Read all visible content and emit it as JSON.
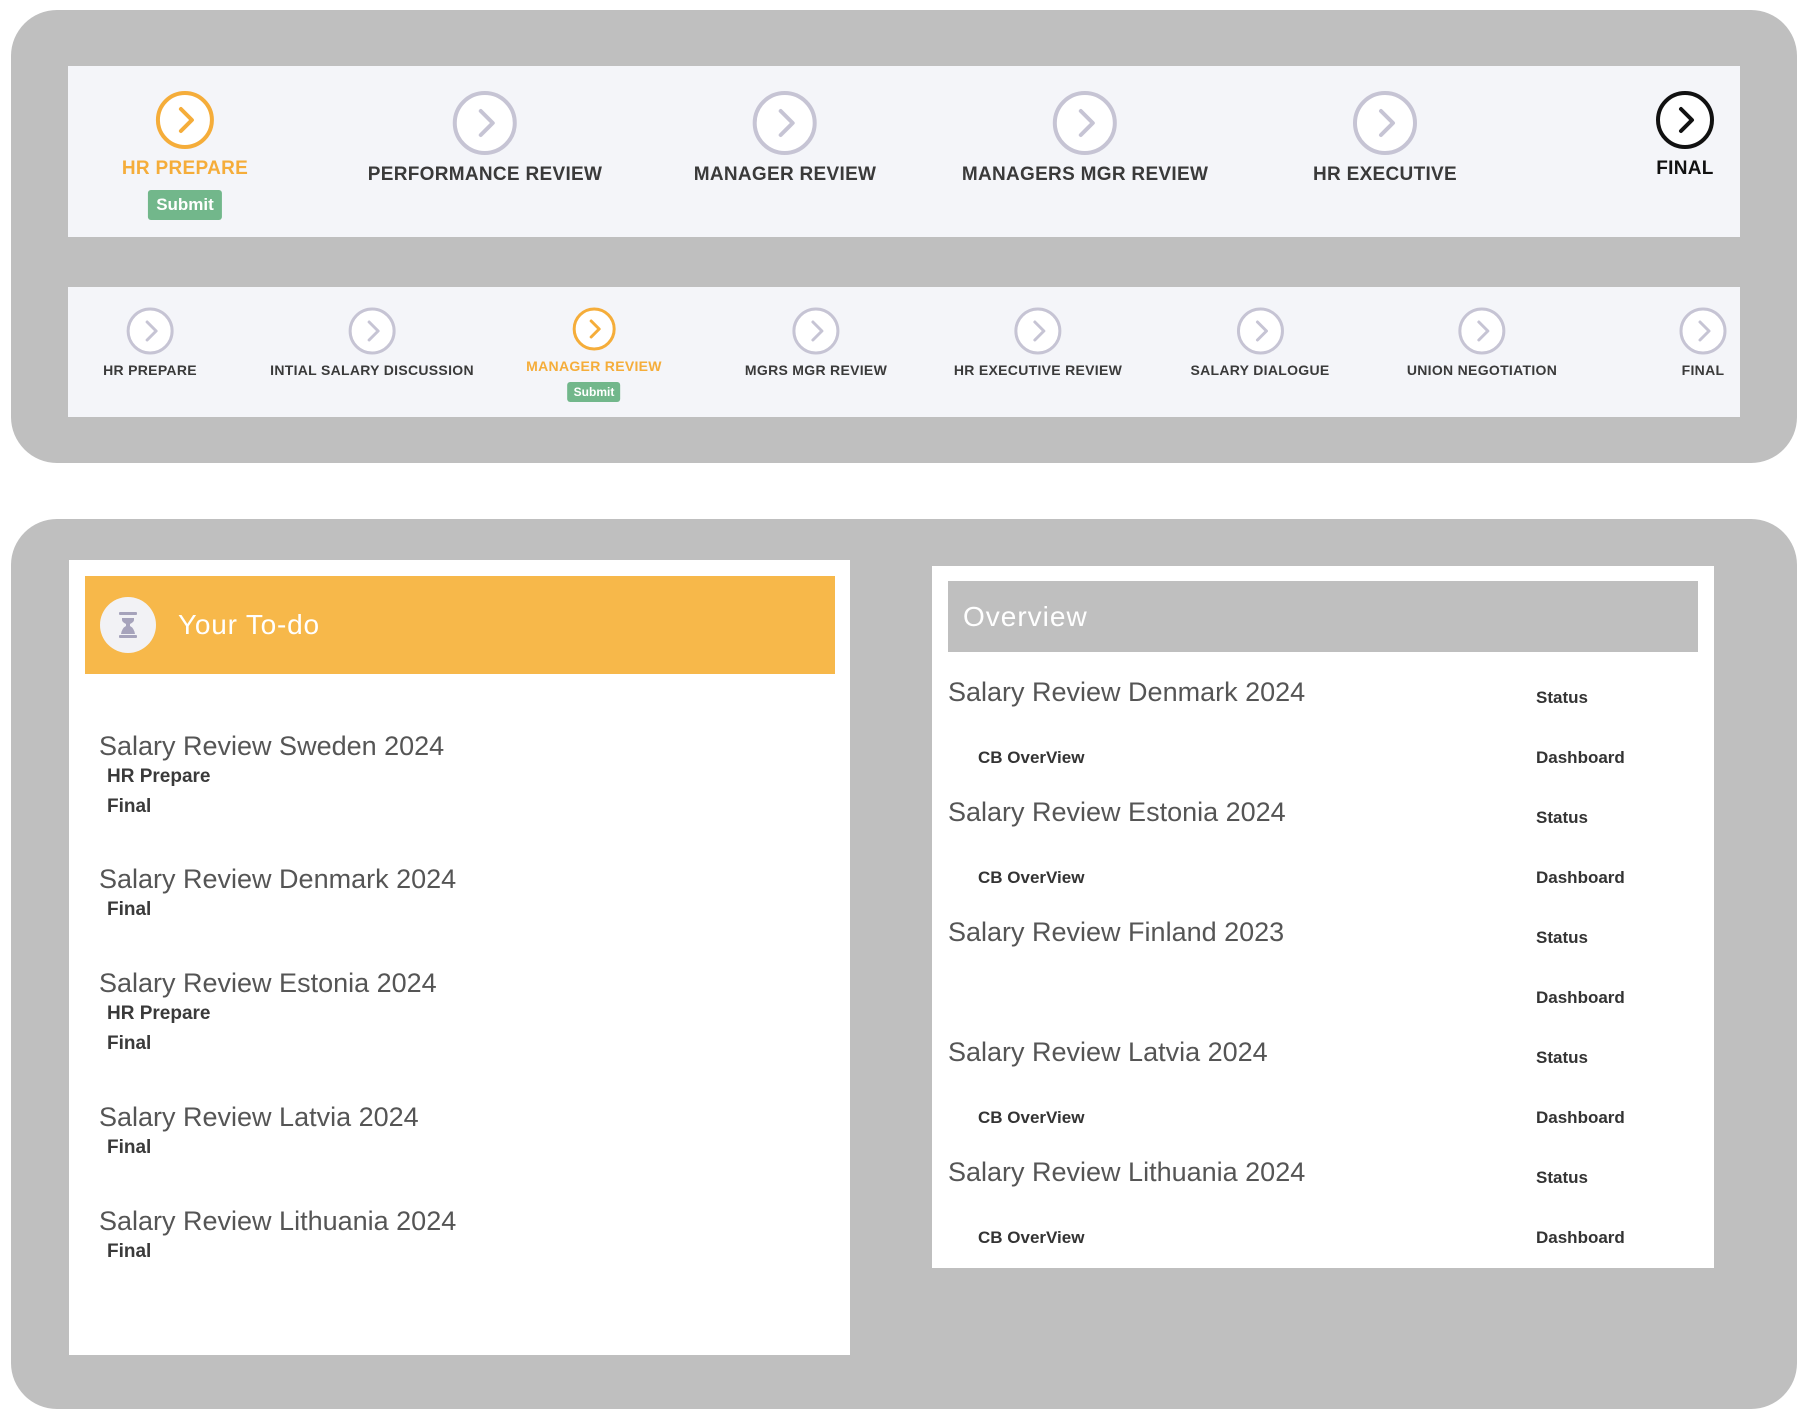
{
  "workflow_primary": {
    "steps": [
      {
        "label": "HR PREPARE",
        "state": "active",
        "submit": "Submit"
      },
      {
        "label": "PERFORMANCE REVIEW",
        "state": "pending"
      },
      {
        "label": "MANAGER REVIEW",
        "state": "pending"
      },
      {
        "label": "MANAGERS MGR REVIEW",
        "state": "pending"
      },
      {
        "label": "HR EXECUTIVE",
        "state": "pending"
      },
      {
        "label": "FINAL",
        "state": "final"
      }
    ]
  },
  "workflow_secondary": {
    "steps": [
      {
        "label": "HR PREPARE",
        "state": "pending"
      },
      {
        "label": "INTIAL SALARY DISCUSSION",
        "state": "pending"
      },
      {
        "label": "MANAGER REVIEW",
        "state": "active",
        "submit": "Submit"
      },
      {
        "label": "MGRS MGR REVIEW",
        "state": "pending"
      },
      {
        "label": "HR EXECUTIVE REVIEW",
        "state": "pending"
      },
      {
        "label": "SALARY DIALOGUE",
        "state": "pending"
      },
      {
        "label": "UNION NEGOTIATION",
        "state": "pending"
      },
      {
        "label": "FINAL",
        "state": "pending"
      }
    ]
  },
  "todo": {
    "title": "Your To-do",
    "icon": "hourglass-icon",
    "items": [
      {
        "title": "Salary Review Sweden 2024",
        "stages": [
          "HR Prepare",
          "Final"
        ]
      },
      {
        "title": "Salary Review Denmark 2024",
        "stages": [
          "Final"
        ]
      },
      {
        "title": "Salary Review Estonia 2024",
        "stages": [
          "HR Prepare",
          "Final"
        ]
      },
      {
        "title": "Salary Review Latvia 2024",
        "stages": [
          "Final"
        ]
      },
      {
        "title": "Salary Review Lithuania 2024",
        "stages": [
          "Final"
        ]
      }
    ]
  },
  "overview": {
    "title": "Overview",
    "items": [
      {
        "title": "Salary Review Denmark 2024",
        "status": "Status",
        "cb": "CB OverView",
        "dashboard": "Dashboard"
      },
      {
        "title": "Salary Review Estonia 2024",
        "status": "Status",
        "cb": "CB OverView",
        "dashboard": "Dashboard"
      },
      {
        "title": "Salary Review Finland 2023",
        "status": "Status",
        "dashboard": "Dashboard"
      },
      {
        "title": "Salary Review Latvia 2024",
        "status": "Status",
        "cb": "CB OverView",
        "dashboard": "Dashboard"
      },
      {
        "title": "Salary Review Lithuania 2024",
        "status": "Status",
        "cb": "CB OverView",
        "dashboard": "Dashboard"
      }
    ]
  },
  "colors": {
    "active": "#f5ad3a",
    "pending": "#c6c4d4",
    "final": "#111111",
    "submit": "#72b78b",
    "todo_header": "#f7b84a",
    "overview_header": "#bfbfbf"
  }
}
